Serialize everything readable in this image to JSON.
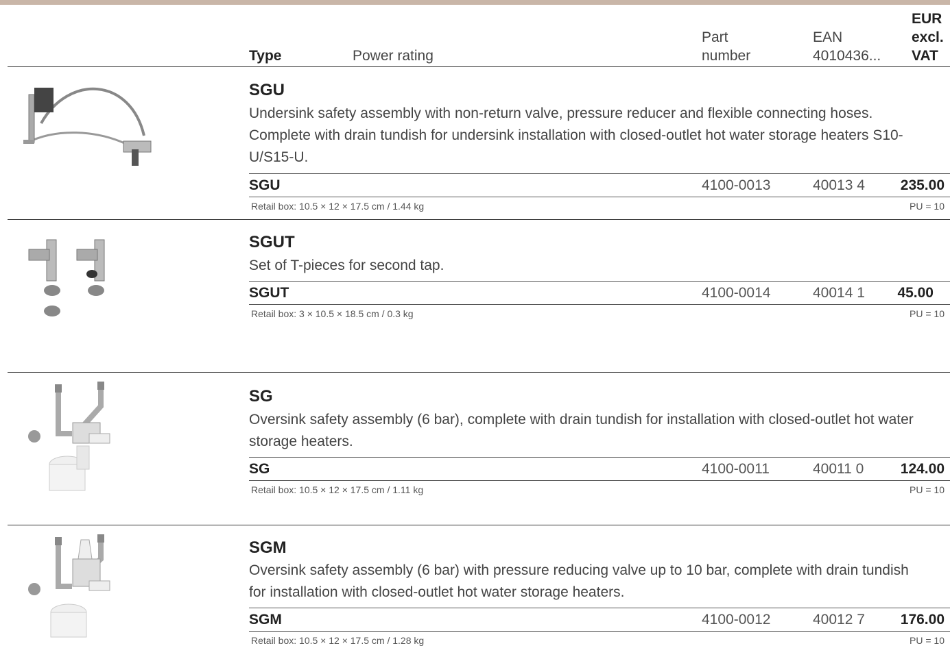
{
  "header": {
    "type": "Type",
    "power_rating": "Power rating",
    "part_number_line1": "Part",
    "part_number_line2": "number",
    "ean_line1": "EAN",
    "ean_line2": "4010436...",
    "price_line1": "EUR",
    "price_line2": "excl.",
    "price_line3": "VAT"
  },
  "products": [
    {
      "name": "SGU",
      "description": "Undersink safety assembly with non-return valve, pressure reducer and flexible connecting hoses. Complete with drain tundish for undersink installation with closed-outlet hot water storage heaters S10-U/S15-U.",
      "order_code": "SGU",
      "part_number": "4100-0013",
      "ean": "40013 4",
      "price": "235.00",
      "retail_box": "Retail box: 10.5 × 12 × 17.5 cm / 1.44 kg",
      "pu": "PU = 10",
      "image_icon": "undersink-assembly-icon"
    },
    {
      "name": "SGUT",
      "description": "Set of T-pieces for second tap.",
      "order_code": "SGUT",
      "part_number": "4100-0014",
      "ean": "40014 1",
      "price": "45.00",
      "retail_box": "Retail box: 3 × 10.5 × 18.5 cm / 0.3 kg",
      "pu": "PU = 10",
      "image_icon": "t-pieces-icon"
    },
    {
      "name": "SG",
      "description": "Oversink safety assembly (6 bar), complete with drain tundish for installation with closed-outlet hot water storage heaters.",
      "order_code": "SG",
      "part_number": "4100-0011",
      "ean": "40011 0",
      "price": "124.00",
      "retail_box": "Retail box: 10.5 × 12 × 17.5 cm / 1.11 kg",
      "pu": "PU = 10",
      "image_icon": "oversink-assembly-icon"
    },
    {
      "name": "SGM",
      "description": "Oversink safety assembly (6 bar) with pressure reducing valve up to 10 bar, complete with drain tundish for installation with closed-outlet hot water storage heaters.",
      "order_code": "SGM",
      "part_number": "4100-0012",
      "ean": "40012 7",
      "price": "176.00",
      "retail_box": "Retail box: 10.5 × 12 × 17.5 cm / 1.28 kg",
      "pu": "PU = 10",
      "image_icon": "oversink-reducer-assembly-icon"
    }
  ]
}
